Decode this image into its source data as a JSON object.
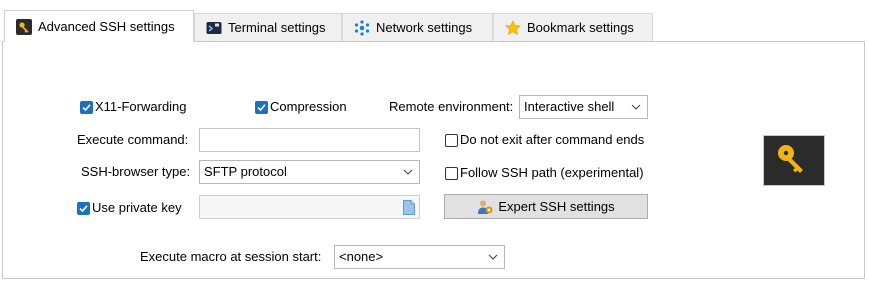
{
  "tabs": [
    {
      "label": "Advanced SSH settings",
      "icon": "key-icon",
      "active": true
    },
    {
      "label": "Terminal settings",
      "icon": "terminal-icon",
      "active": false
    },
    {
      "label": "Network settings",
      "icon": "network-icon",
      "active": false
    },
    {
      "label": "Bookmark settings",
      "icon": "star-icon",
      "active": false
    }
  ],
  "options": {
    "x11_forwarding": {
      "label": "X11-Forwarding",
      "checked": true
    },
    "compression": {
      "label": "Compression",
      "checked": true
    },
    "remote_env": {
      "label": "Remote environment:",
      "value": "Interactive shell"
    },
    "execute_command": {
      "label": "Execute command:",
      "value": ""
    },
    "no_exit": {
      "label": "Do not exit after command ends",
      "checked": false
    },
    "browser_type": {
      "label": "SSH-browser type:",
      "value": "SFTP protocol"
    },
    "follow_path": {
      "label": "Follow SSH path (experimental)",
      "checked": false
    },
    "private_key": {
      "label": "Use private key",
      "checked": true,
      "value": ""
    },
    "expert_button": {
      "label": "Expert SSH settings"
    },
    "macro": {
      "label": "Execute macro at session start:",
      "value": "<none>"
    }
  },
  "colors": {
    "accent": "#1d70bf",
    "key_tile": "#2b2b2b",
    "key_gold": "#f2b413"
  }
}
